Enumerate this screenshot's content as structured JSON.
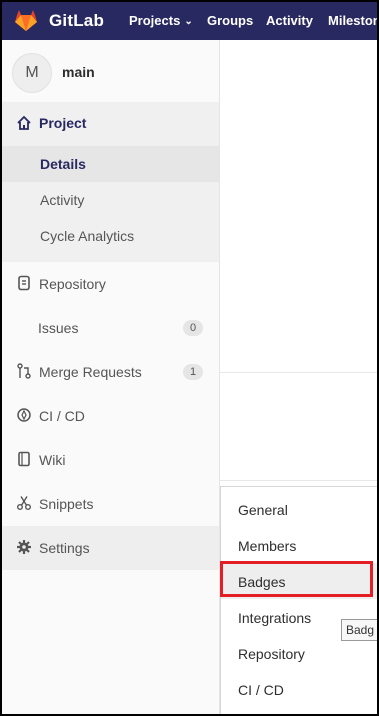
{
  "header": {
    "brand": "GitLab",
    "nav": {
      "projects": "Projects",
      "groups": "Groups",
      "activity": "Activity",
      "milestones": "Mileston"
    },
    "icons": {
      "logo": "gitlab-tanuki-logo",
      "projects_caret": "chevron-down-icon"
    }
  },
  "sidebar": {
    "context": {
      "avatar_letter": "M",
      "name": "main"
    },
    "project": {
      "label": "Project",
      "icon": "home-icon",
      "subitems": [
        "Details",
        "Activity",
        "Cycle Analytics"
      ]
    },
    "items": [
      {
        "label": "Repository",
        "icon": "document-icon"
      },
      {
        "label": "Issues",
        "count": "0"
      },
      {
        "label": "Merge Requests",
        "icon": "git-merge-icon",
        "count": "1"
      },
      {
        "label": "CI / CD",
        "icon": "rocket-icon"
      },
      {
        "label": "Wiki",
        "icon": "book-icon"
      },
      {
        "label": "Snippets",
        "icon": "scissors-icon"
      },
      {
        "label": "Settings",
        "icon": "gear-icon"
      }
    ]
  },
  "settings_flyout": {
    "items": [
      "General",
      "Members",
      "Badges",
      "Integrations",
      "Repository",
      "CI / CD"
    ],
    "highlighted": "Badges"
  },
  "tooltip": {
    "text": "Badg"
  },
  "colors": {
    "header_bg": "#292961",
    "accent_red": "#e31e24",
    "active_text": "#292961"
  }
}
